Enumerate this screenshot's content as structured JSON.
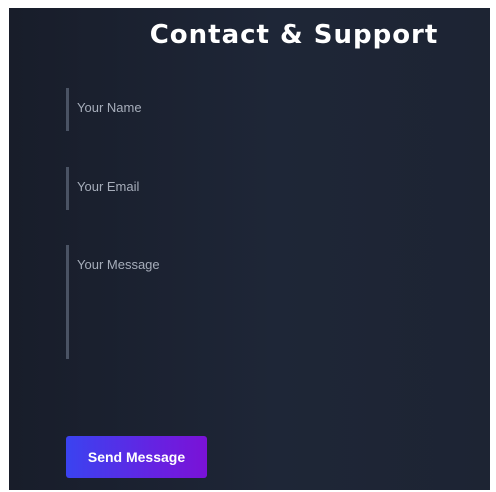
{
  "page": {
    "title": "Contact & Support"
  },
  "form": {
    "name_placeholder": "Your Name",
    "email_placeholder": "Your Email",
    "message_placeholder": "Your Message",
    "submit_label": "Send Message"
  },
  "colors": {
    "background": "#1e2637",
    "field_border": "#4a5364",
    "placeholder_text": "#a6adba",
    "button_gradient_start": "#3a43f0",
    "button_gradient_end": "#7a12d6"
  }
}
